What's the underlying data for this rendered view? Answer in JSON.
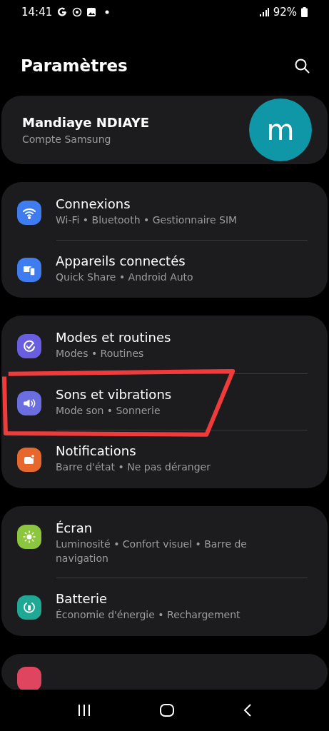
{
  "status_bar": {
    "time": "14:41",
    "battery": "92%"
  },
  "header": {
    "title": "Paramètres"
  },
  "account": {
    "name": "Mandiaye NDIAYE",
    "subtitle": "Compte Samsung",
    "avatar_letter": "m"
  },
  "groups": [
    {
      "items": [
        {
          "title": "Connexions",
          "subtitle": "Wi-Fi • Bluetooth • Gestionnaire SIM",
          "kind": "wifi",
          "color": "#3f7cf0",
          "circled": false
        },
        {
          "title": "Appareils connectés",
          "subtitle": "Quick Share • Android Auto",
          "kind": "devices",
          "color": "#3f7cf0",
          "circled": false
        }
      ]
    },
    {
      "items": [
        {
          "title": "Modes et routines",
          "subtitle": "Modes • Routines",
          "kind": "check",
          "color": "#6a5ee0",
          "circled": false
        },
        {
          "title": "Sons et vibrations",
          "subtitle": "Mode son • Sonnerie",
          "kind": "sound",
          "color": "#6a6ee0",
          "circled": true
        },
        {
          "title": "Notifications",
          "subtitle": "Barre d'état • Ne pas déranger",
          "kind": "notif",
          "color": "#e8672c",
          "circled": false
        }
      ]
    },
    {
      "items": [
        {
          "title": "Écran",
          "subtitle": "Luminosité • Confort visuel • Barre de navigation",
          "kind": "sun",
          "color": "#8cc63f",
          "circled": false
        },
        {
          "title": "Batterie",
          "subtitle": "Économie d'énergie • Rechargement",
          "kind": "battery",
          "color": "#1fa893",
          "circled": false
        }
      ]
    },
    {
      "items": [
        {
          "kind": "partial",
          "color": "#e0455f"
        }
      ]
    }
  ]
}
